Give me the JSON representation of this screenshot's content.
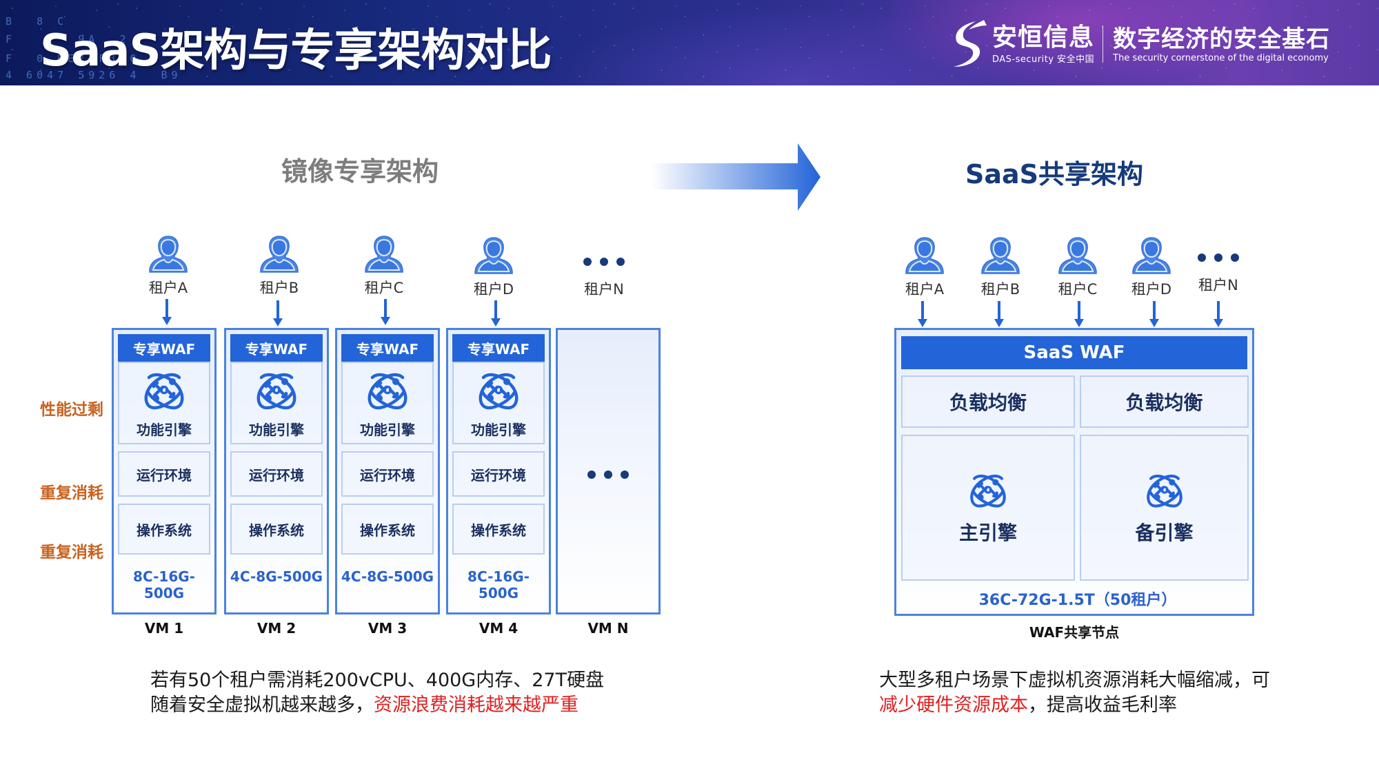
{
  "header": {
    "title": "SaaS架构与专享架构对比",
    "hex_lines": [
      "B  8 C",
      "F   E  9A  2",
      "F  0 BE2 F3D0",
      "4 6047 5926 4  B9"
    ],
    "logo": {
      "name_cn": "安恒信息",
      "name_en": "DAS-security 安全中国",
      "slogan_cn": "数字经济的安全基石",
      "slogan_en": "The security cornerstone of the digital economy"
    }
  },
  "colors": {
    "primary_blue": "#2364d8",
    "border_blue": "#4a82e0",
    "dark_navy": "#1a2f5e",
    "warning_orange": "#c8621f",
    "highlight_red": "#e02020",
    "gray_title": "#7d7d7d"
  },
  "left": {
    "title": "镜像专享架构",
    "side_labels": [
      "性能过剩",
      "重复消耗",
      "重复消耗"
    ],
    "tenants": [
      {
        "name": "租户A",
        "icon": "person-icon"
      },
      {
        "name": "租户B",
        "icon": "person-icon"
      },
      {
        "name": "租户C",
        "icon": "person-icon"
      },
      {
        "name": "租户D",
        "icon": "person-icon"
      },
      {
        "name": "租户N",
        "icon": "ellipsis-icon"
      }
    ],
    "vms": [
      {
        "waf": "专享WAF",
        "engine": "功能引擎",
        "runtime": "运行环境",
        "os": "操作系统",
        "spec": "8C-16G-500G",
        "label": "VM 1"
      },
      {
        "waf": "专享WAF",
        "engine": "功能引擎",
        "runtime": "运行环境",
        "os": "操作系统",
        "spec": "4C-8G-500G",
        "label": "VM 2"
      },
      {
        "waf": "专享WAF",
        "engine": "功能引擎",
        "runtime": "运行环境",
        "os": "操作系统",
        "spec": "4C-8G-500G",
        "label": "VM 3"
      },
      {
        "waf": "专享WAF",
        "engine": "功能引擎",
        "runtime": "运行环境",
        "os": "操作系统",
        "spec": "8C-16G-500G",
        "label": "VM 4"
      }
    ],
    "vm_n_label": "VM N",
    "caption": {
      "line1": "若有50个租户需消耗200vCPU、400G内存、27T硬盘",
      "line2_normal": "随着安全虚拟机越来越多，",
      "line2_red": "资源浪费消耗越来越严重"
    }
  },
  "right": {
    "title": "SaaS共享架构",
    "tenants": [
      {
        "name": "租户A",
        "icon": "person-icon"
      },
      {
        "name": "租户B",
        "icon": "person-icon"
      },
      {
        "name": "租户C",
        "icon": "person-icon"
      },
      {
        "name": "租户D",
        "icon": "person-icon"
      },
      {
        "name": "租户N",
        "icon": "ellipsis-icon"
      }
    ],
    "node": {
      "waf": "SaaS WAF",
      "lb_left": "负载均衡",
      "lb_right": "负载均衡",
      "engine_main": "主引擎",
      "engine_backup": "备引擎",
      "spec": "36C-72G-1.5T（50租户）",
      "label": "WAF共享节点"
    },
    "caption": {
      "line1": "大型多租户场景下虚拟机资源消耗大幅缩减，可",
      "line2_red": "减少硬件资源成本",
      "line2_normal": "，提高收益毛利率"
    }
  }
}
